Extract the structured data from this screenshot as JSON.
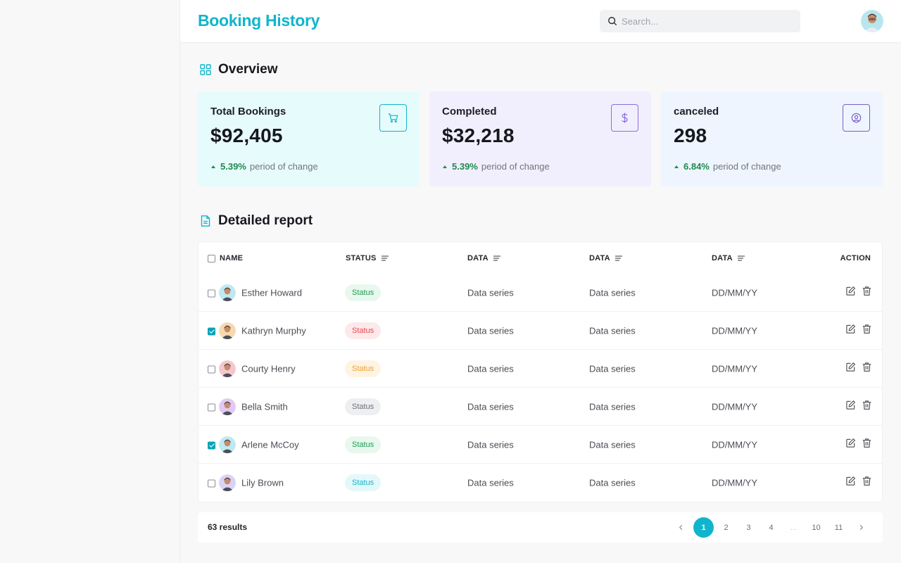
{
  "header": {
    "title": "Booking History",
    "search_placeholder": "Search..."
  },
  "overview": {
    "title": "Overview",
    "cards": [
      {
        "label": "Total Bookings",
        "value": "$92,405",
        "change_pct": "5.39%",
        "change_text": "period of change",
        "icon": "cart-icon",
        "bg": "#e6fbfc",
        "icon_color": "#10b5cb"
      },
      {
        "label": "Completed",
        "value": "$32,218",
        "change_pct": "5.39%",
        "change_text": "period of change",
        "icon": "dollar-icon",
        "bg": "#f1effd",
        "icon_color": "#8a6fd8"
      },
      {
        "label": "canceled",
        "value": "298",
        "change_pct": "6.84%",
        "change_text": "period of change",
        "icon": "user-circle-icon",
        "bg": "#eef5fe",
        "icon_color": "#7a5fc9"
      }
    ]
  },
  "report": {
    "title": "Detailed report",
    "columns": {
      "name": "NAME",
      "status": "STATUS",
      "data1": "DATA",
      "data2": "DATA",
      "data3": "DATA",
      "action": "ACTION"
    },
    "rows": [
      {
        "name": "Esther Howard",
        "checked": false,
        "status": "Status",
        "status_color": "#1f9d55",
        "status_bg": "#e8f8ee",
        "data1": "Data series",
        "data2": "Data series",
        "date": "DD/MM/YY",
        "avatar_bg": "#bfe9f2"
      },
      {
        "name": "Kathryn Murphy",
        "checked": true,
        "status": "Status",
        "status_color": "#e5484d",
        "status_bg": "#fde9ea",
        "data1": "Data series",
        "data2": "Data series",
        "date": "DD/MM/YY",
        "avatar_bg": "#f7d9b0"
      },
      {
        "name": "Courty Henry",
        "checked": false,
        "status": "Status",
        "status_color": "#f0a030",
        "status_bg": "#fff3e2",
        "data1": "Data series",
        "data2": "Data series",
        "date": "DD/MM/YY",
        "avatar_bg": "#f4c7cf"
      },
      {
        "name": "Bella Smith",
        "checked": false,
        "status": "Status",
        "status_color": "#6d7078",
        "status_bg": "#eeeff1",
        "data1": "Data series",
        "data2": "Data series",
        "date": "DD/MM/YY",
        "avatar_bg": "#e2c8f4"
      },
      {
        "name": "Arlene McCoy",
        "checked": true,
        "status": "Status",
        "status_color": "#1f9d55",
        "status_bg": "#e8f8ee",
        "data1": "Data series",
        "data2": "Data series",
        "date": "DD/MM/YY",
        "avatar_bg": "#bfe9f2"
      },
      {
        "name": "Lily Brown",
        "checked": false,
        "status": "Status",
        "status_color": "#10b5cb",
        "status_bg": "#e4f8fa",
        "data1": "Data series",
        "data2": "Data series",
        "date": "DD/MM/YY",
        "avatar_bg": "#d9d3f7"
      }
    ]
  },
  "footer": {
    "results": "63 results",
    "pages": [
      "1",
      "2",
      "3",
      "4",
      "...",
      "10",
      "11"
    ],
    "active_page": "1"
  },
  "colors": {
    "accent": "#10b5cb",
    "positive": "#1f8a4c"
  }
}
